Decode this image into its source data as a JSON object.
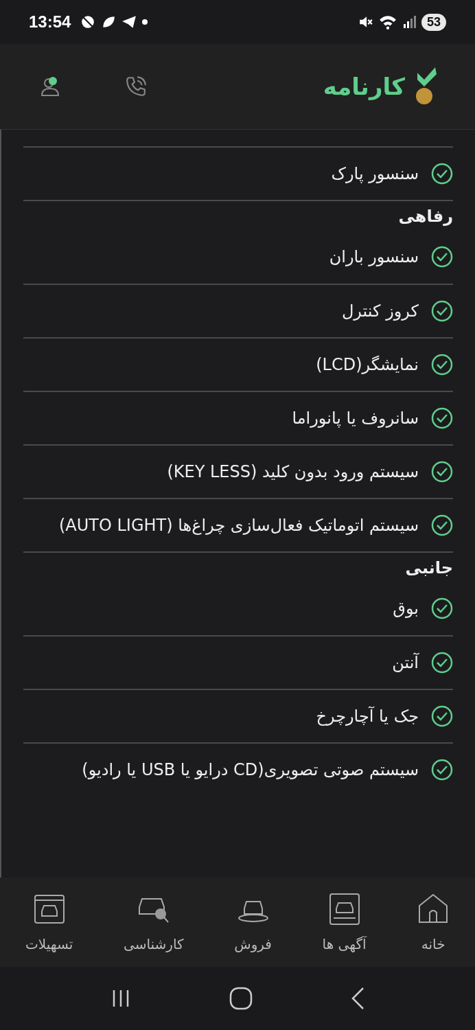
{
  "status_bar": {
    "time": "13:54",
    "battery": "53"
  },
  "header": {
    "logo_text": "کارنامه"
  },
  "sections": [
    {
      "kind": "items",
      "items": [
        {
          "label": "سنسور پارک",
          "checked": true
        }
      ]
    },
    {
      "kind": "group",
      "title": "رفاهی",
      "items": [
        {
          "label": "سنسور باران",
          "checked": true
        },
        {
          "label": "کروز کنترل",
          "checked": true
        },
        {
          "label": "نمایشگر(LCD)",
          "checked": true
        },
        {
          "label": "سانروف یا پانوراما",
          "checked": true
        },
        {
          "label": "سیستم ورود بدون کلید (KEY LESS)",
          "checked": true
        },
        {
          "label": "سیستم اتوماتیک فعال‌سازی چراغ‌ها (AUTO LIGHT)",
          "checked": true
        }
      ]
    },
    {
      "kind": "group",
      "title": "جانبی",
      "items": [
        {
          "label": "بوق",
          "checked": true
        },
        {
          "label": "آنتن",
          "checked": true
        },
        {
          "label": "جک یا آچارچرخ",
          "checked": true
        },
        {
          "label": "سیستم صوتی تصویری(CD درایو یا USB یا رادیو)",
          "checked": true
        }
      ]
    }
  ],
  "bottom_nav": [
    {
      "label": "خانه",
      "kind": "home"
    },
    {
      "label": "آگهی ها",
      "kind": "ads"
    },
    {
      "label": "فروش",
      "kind": "sale"
    },
    {
      "label": "کارشناسی",
      "kind": "inspection"
    },
    {
      "label": "تسهیلات",
      "kind": "loan"
    }
  ]
}
